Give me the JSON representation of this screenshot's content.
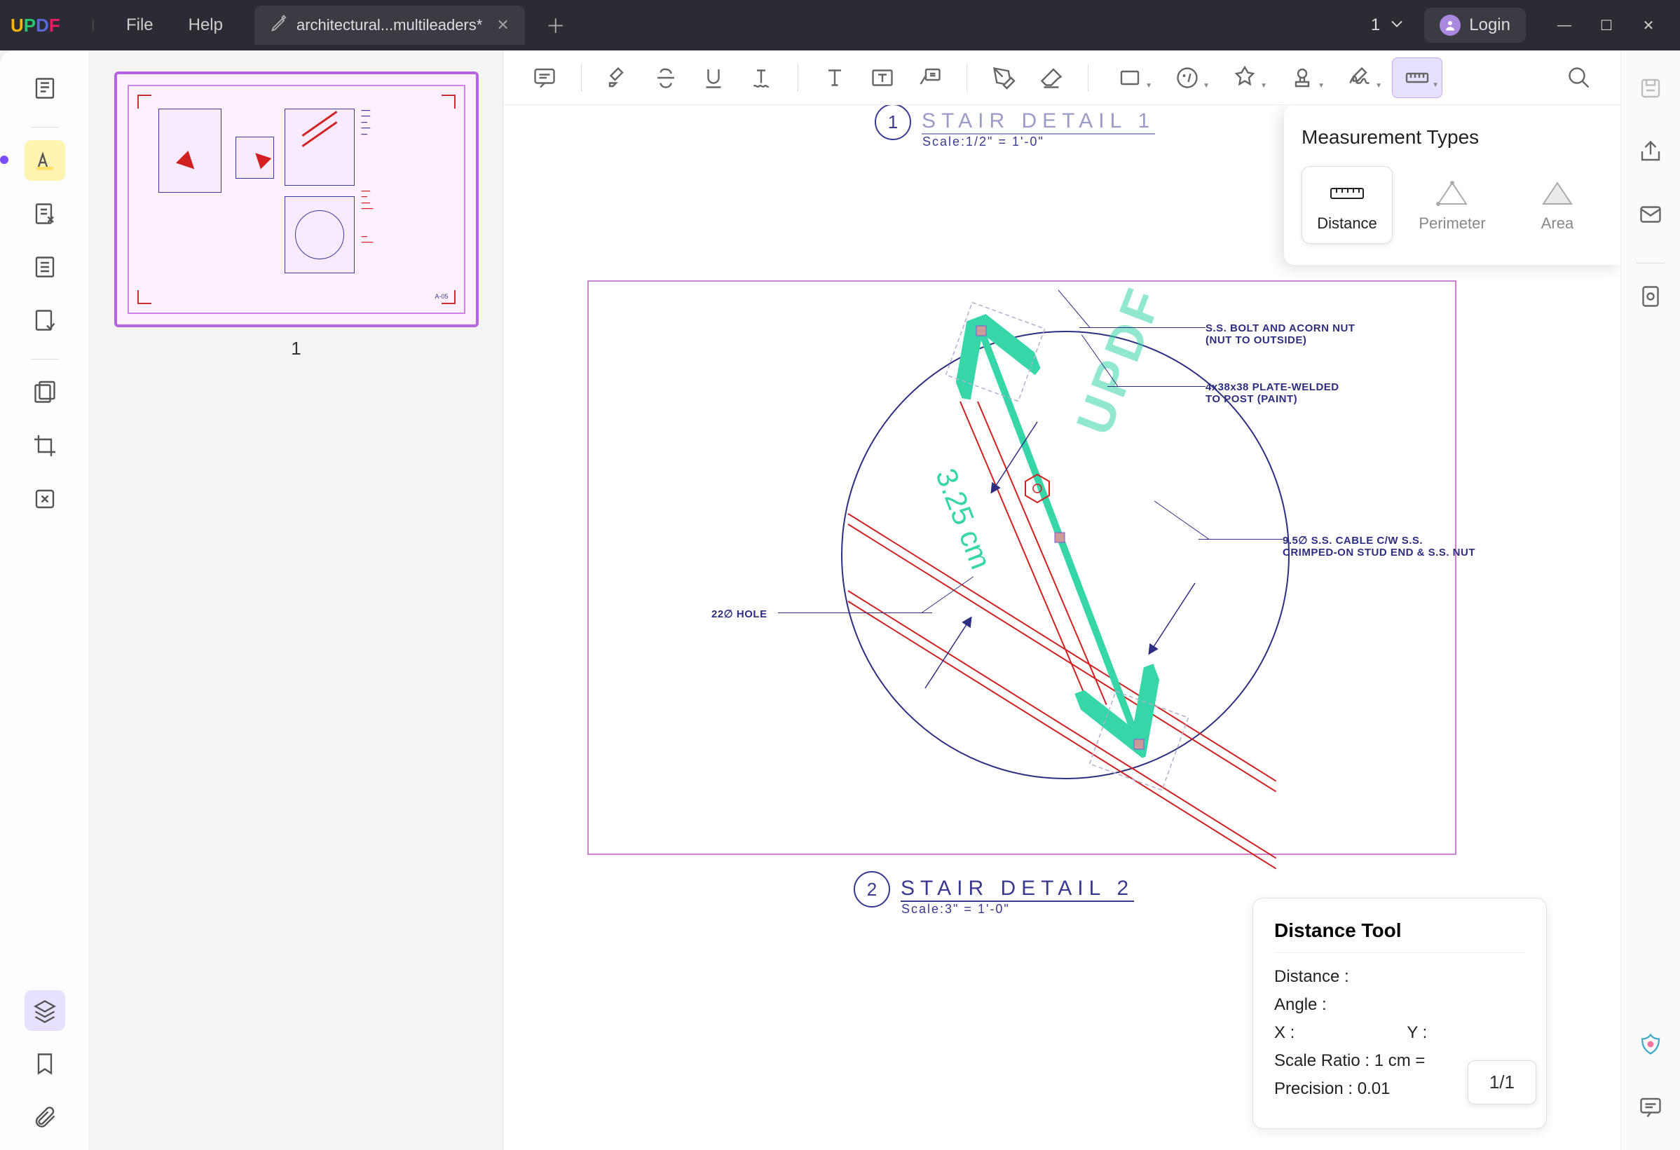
{
  "app": {
    "name_u": "U",
    "name_p": "P",
    "name_d": "D",
    "name_f": "F"
  },
  "menu": {
    "file": "File",
    "help": "Help"
  },
  "tab": {
    "title": "architectural...multileaders*"
  },
  "titlebar": {
    "page_indicator": "1",
    "login": "Login"
  },
  "thumbnail": {
    "number": "1"
  },
  "measurement": {
    "panel_title": "Measurement Types",
    "distance": "Distance",
    "perimeter": "Perimeter",
    "area": "Area"
  },
  "distance_tool": {
    "title": "Distance Tool",
    "distance_label": "Distance :",
    "angle_label": "Angle :",
    "x_label": "X :",
    "y_label": "Y :",
    "scale_ratio": "Scale Ratio : 1 cm =",
    "precision": "Precision : 0.01"
  },
  "page_nav": {
    "value": "1/1"
  },
  "drawing": {
    "detail1": {
      "num": "1",
      "title": "STAIR DETAIL 1",
      "scale": "Scale:1/2\" = 1'-0\""
    },
    "detail2": {
      "num": "2",
      "title": "STAIR DETAIL 2",
      "scale": "Scale:3\" = 1'-0\""
    },
    "callouts": {
      "bolt": "S.S. BOLT AND ACORN NUT",
      "bolt2": "(NUT TO OUTSIDE)",
      "plate": "4x38x38 PLATE-WELDED",
      "plate2": "TO POST (PAINT)",
      "cable": "9.5∅ S.S. CABLE C/W S.S.",
      "cable2": "CRIMPED-ON STUD END & S.S. NUT",
      "hole": "22∅ HOLE"
    },
    "measure_value": "3.25 cm",
    "watermark": "UPDF"
  }
}
